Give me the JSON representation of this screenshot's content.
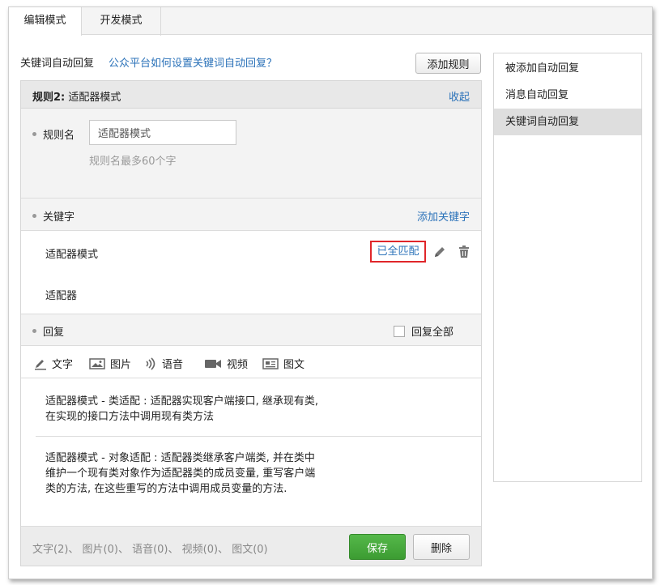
{
  "tabs": [
    {
      "label": "编辑模式",
      "active": true
    },
    {
      "label": "开发模式",
      "active": false
    }
  ],
  "header": {
    "title": "关键词自动回复",
    "help_link": "公众平台如何设置关键词自动回复？",
    "add_rule_label": "添加规则"
  },
  "rule": {
    "title_prefix": "规则2:",
    "title_name": "适配器模式",
    "collapse_label": "收起",
    "name_label": "规则名",
    "name_value": "适配器模式",
    "name_hint": "规则名最多60个字",
    "keyword_label": "关键字",
    "add_keyword_label": "添加关键字",
    "keywords": [
      {
        "text": "适配器模式",
        "match_label": "已全匹配"
      },
      {
        "text": "适配器"
      }
    ],
    "reply_label": "回复",
    "reply_all_label": "回复全部",
    "media_types": [
      "文字",
      "图片",
      "语音",
      "视频",
      "图文"
    ],
    "replies": [
      "适配器模式 - 类适配 : 适配器实现客户端接口, 继承现有类, 在实现的接口方法中调用现有类方法",
      "适配器模式 - 对象适配 : 适配器类继承客户端类, 并在类中维护一个现有类对象作为适配器类的成员变量, 重写客户端类的方法, 在这些重写的方法中调用成员变量的方法."
    ],
    "counts_summary": "文字(2)、 图片(0)、 语音(0)、 视频(0)、 图文(0)",
    "save_label": "保存",
    "delete_label": "删除"
  },
  "sidebar": {
    "items": [
      {
        "label": "被添加自动回复",
        "active": false
      },
      {
        "label": "消息自动回复",
        "active": false
      },
      {
        "label": "关键词自动回复",
        "active": true
      }
    ]
  },
  "colors": {
    "link": "#2b72b9",
    "save_button": "#45a83b",
    "highlight_border": "#e0262a"
  }
}
